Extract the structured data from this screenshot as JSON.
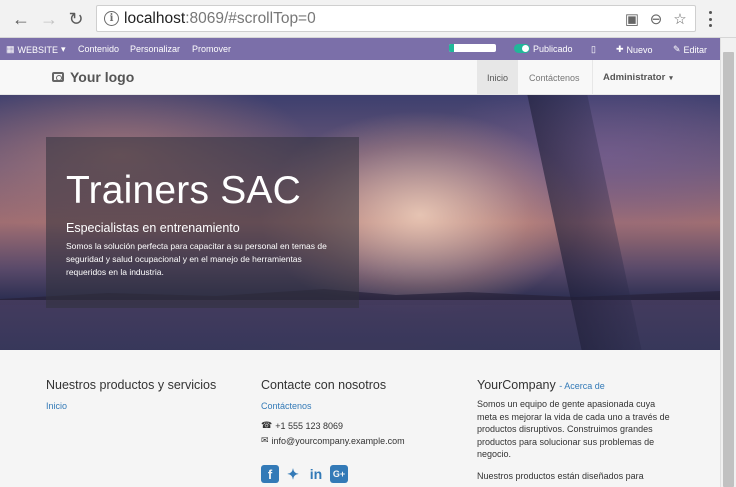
{
  "browser": {
    "url_host": "localhost",
    "url_rest": ":8069/#scrollTop=0"
  },
  "editbar": {
    "website_label": "WEBSITE",
    "content_label": "Contenido",
    "customize_label": "Personalizar",
    "promote_label": "Promover",
    "progress_fraction": 0.1,
    "published_label": "Publicado",
    "new_label": "Nuevo",
    "edit_label": "Editar"
  },
  "header": {
    "logo_text": "Your logo",
    "nav": [
      {
        "label": "Inicio"
      },
      {
        "label": "Contáctenos"
      }
    ],
    "admin_label": "Administrator"
  },
  "hero": {
    "title": "Trainers SAC",
    "subtitle": "Especialistas en entrenamiento",
    "description": "Somos la solución perfecta para capacitar a su personal en temas de seguridad y salud ocupacional y en el manejo de herramientas requeridos en la industria."
  },
  "footer": {
    "products_title": "Nuestros productos y servicios",
    "products_link": "Inicio",
    "contact_title": "Contacte con nosotros",
    "contact_link": "Contáctenos",
    "phone": "+1 555 123 8069",
    "email": "info@yourcompany.example.com",
    "company_title": "YourCompany",
    "about_link": "- Acerca de",
    "about_text_1": "Somos un equipo de gente apasionada cuya meta es mejorar la vida de cada uno a través de productos disruptivos. Construimos grandes productos para solucionar sus problemas de negocio.",
    "about_text_2": "Nuestros productos están diseñados para"
  },
  "colors": {
    "editbar": "#7b6fa9",
    "accent": "#21b799",
    "link": "#337ab7"
  }
}
